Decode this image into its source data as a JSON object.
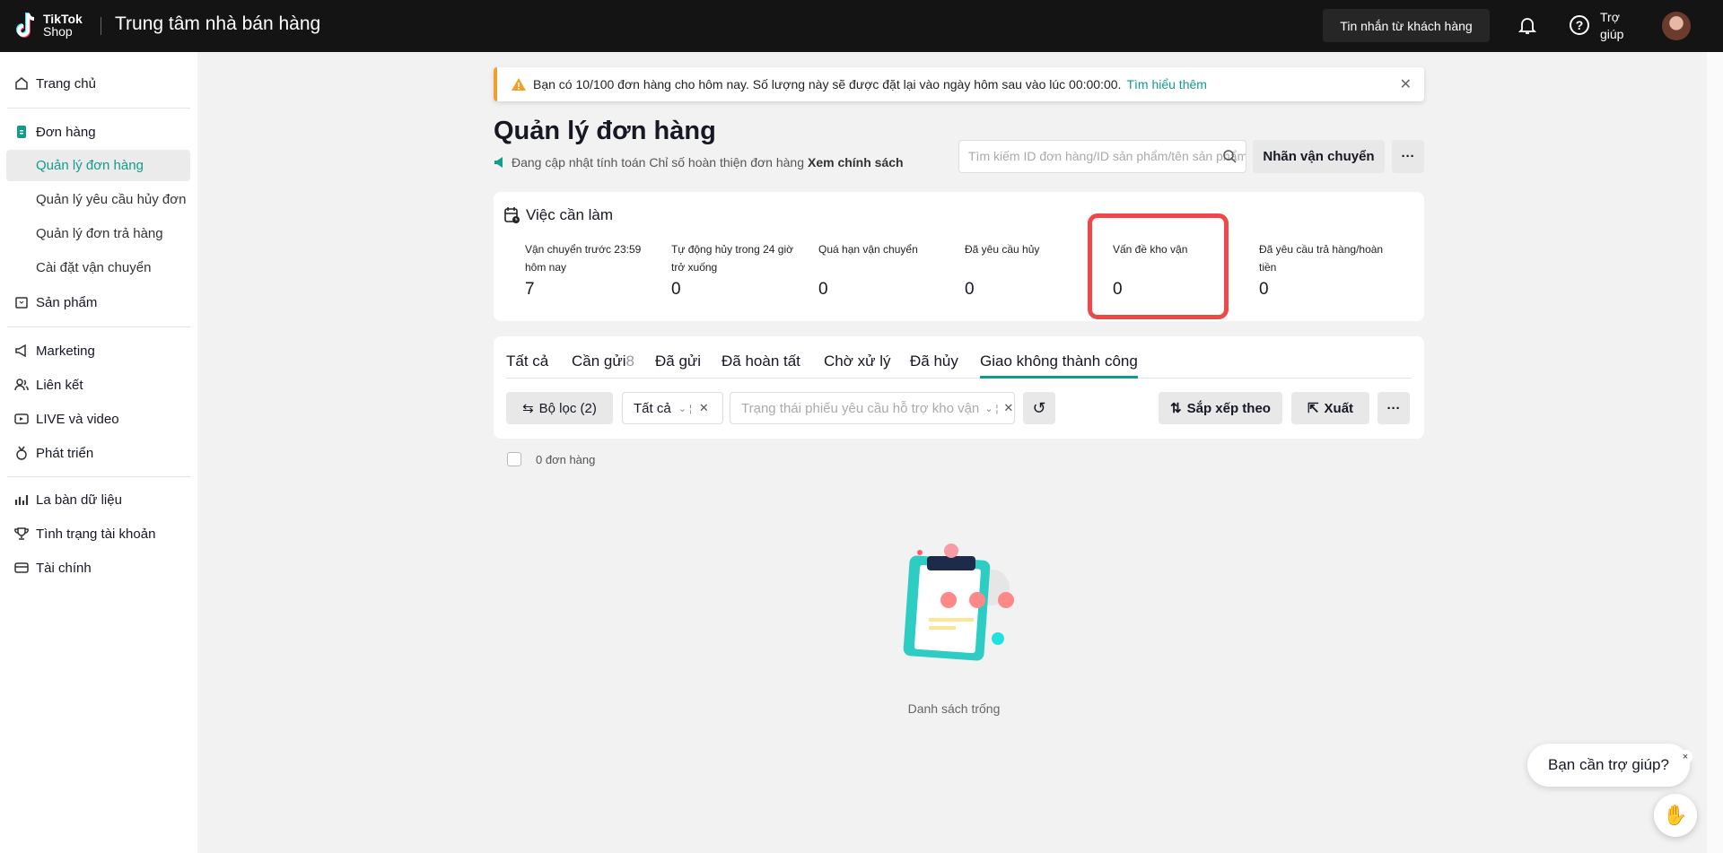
{
  "header": {
    "logo_line1": "TikTok",
    "logo_line2": "Shop",
    "title": "Trung tâm nhà bán hàng",
    "messages_button": "Tin nhắn từ khách hàng",
    "help_label": "Trợ giúp"
  },
  "sidebar": {
    "home": "Trang chủ",
    "orders": "Đơn hàng",
    "orders_sub": [
      "Quản lý đơn hàng",
      "Quản lý yêu cầu hủy đơn",
      "Quản lý đơn trả hàng",
      "Cài đặt vận chuyển"
    ],
    "products": "Sản phẩm",
    "marketing": "Marketing",
    "affiliate": "Liên kết",
    "live": "LIVE và video",
    "growth": "Phát triển",
    "data_compass": "La bàn dữ liệu",
    "account_health": "Tình trạng tài khoản",
    "finance": "Tài chính"
  },
  "banner": {
    "text": "Bạn có 10/100 đơn hàng cho hôm nay. Số lượng này sẽ được đặt lại vào ngày hôm sau vào lúc 00:00:00.",
    "link": "Tìm hiểu thêm"
  },
  "page": {
    "title": "Quản lý đơn hàng",
    "subtitle": "Đang cập nhật tính toán Chỉ số hoàn thiện đơn hàng",
    "subtitle_link": "Xem chính sách",
    "search_placeholder": "Tìm kiếm ID đơn hàng/ID sản phẩm/tên sản phẩm",
    "label_button": "Nhãn vận chuyển",
    "more": "···"
  },
  "tasks": {
    "title": "Việc cần làm",
    "items": [
      {
        "label": "Vận chuyển trước 23:59 hôm nay",
        "value": "7"
      },
      {
        "label": "Tự động hủy trong 24 giờ trở xuống",
        "value": "0"
      },
      {
        "label": "Quá hạn vận chuyển",
        "value": "0"
      },
      {
        "label": "Đã yêu cầu hủy",
        "value": "0"
      },
      {
        "label": "Vấn đề kho vận",
        "value": "0"
      },
      {
        "label": "Đã yêu cầu trả hàng/hoàn tiền",
        "value": "0"
      }
    ]
  },
  "tabs": {
    "items": [
      {
        "label": "Tất cả"
      },
      {
        "label": "Cần gửi",
        "count": "8"
      },
      {
        "label": "Đã gửi"
      },
      {
        "label": "Đã hoàn tất"
      },
      {
        "label": "Chờ xử lý"
      },
      {
        "label": "Đã hủy"
      },
      {
        "label": "Giao không thành công"
      }
    ],
    "active": "Giao không thành công"
  },
  "filters": {
    "filter_button": "Bộ lọc",
    "filter_count": "(2)",
    "select_all": "Tất cả",
    "status_placeholder": "Trạng thái phiếu yêu cầu hỗ trợ kho vận",
    "sort": "Sắp xếp theo",
    "export": "Xuất",
    "more": "···"
  },
  "list": {
    "count_text": "0 đơn hàng",
    "empty_text": "Danh sách trống"
  },
  "help_widget": {
    "bubble": "Bạn cần trợ giúp?",
    "close": "×"
  },
  "colors": {
    "accent": "#129c8c",
    "highlight": "#f04848",
    "header_bg": "#141414",
    "warning": "#f29f2a"
  }
}
